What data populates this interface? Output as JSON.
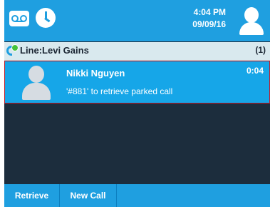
{
  "status_bar": {
    "time": "4:04 PM",
    "date": "09/09/16",
    "icons": [
      "voicemail-icon",
      "clock-icon",
      "user-avatar-icon"
    ]
  },
  "line": {
    "label": "Line:Levi Gains",
    "count": "(1)",
    "presence_color": "#44c23a"
  },
  "call": {
    "name": "Nikki Nguyen",
    "subtitle": "'#881' to retrieve parked call",
    "duration": "0:04"
  },
  "softkeys": [
    {
      "label": "Retrieve"
    },
    {
      "label": "New Call"
    }
  ],
  "colors": {
    "accent": "#1f9fe0",
    "selected_row": "#16a6e8",
    "background": "#1c2d3d",
    "line_bar": "#d9e9ee"
  }
}
